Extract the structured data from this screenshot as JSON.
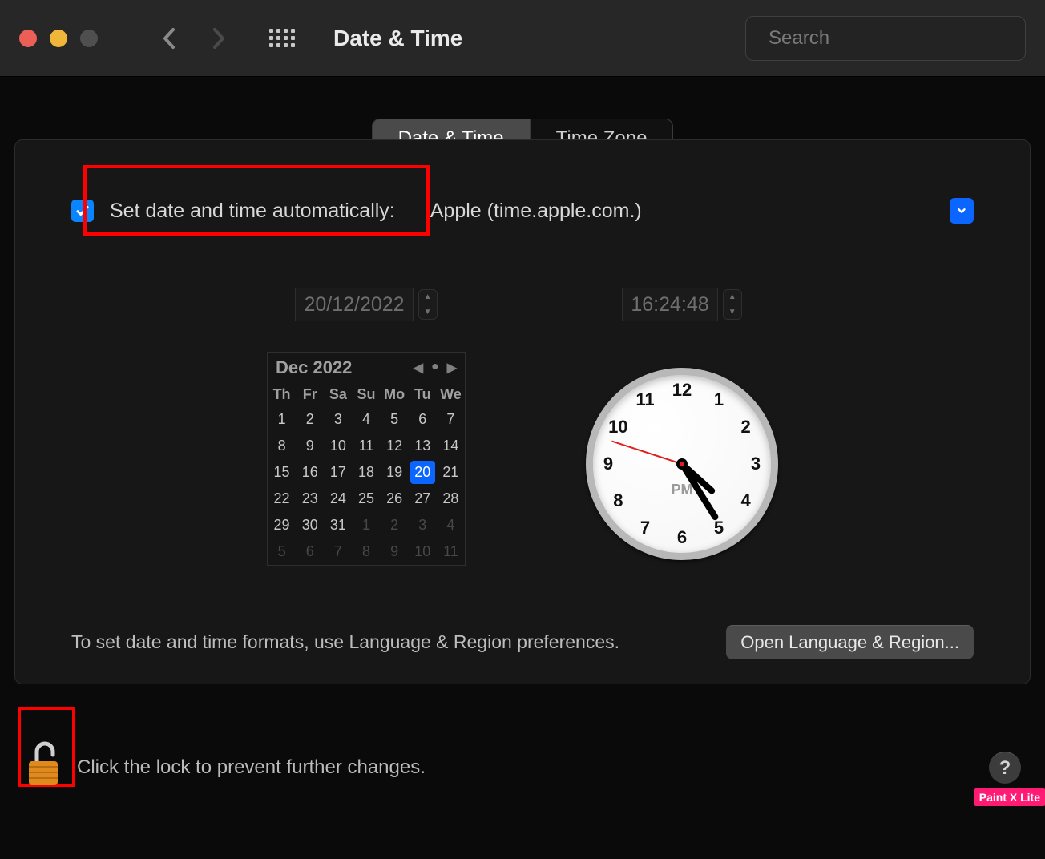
{
  "window": {
    "title": "Date & Time"
  },
  "search": {
    "placeholder": "Search",
    "value": ""
  },
  "tabs": {
    "date_time": "Date & Time",
    "time_zone": "Time Zone"
  },
  "auto": {
    "checked": true,
    "label": "Set date and time automatically:",
    "server": "Apple (time.apple.com.)"
  },
  "date_field": "20/12/2022",
  "time_field": "16:24:48",
  "calendar": {
    "month_label": "Dec 2022",
    "dow": [
      "Th",
      "Fr",
      "Sa",
      "Su",
      "Mo",
      "Tu",
      "We"
    ],
    "weeks": [
      [
        {
          "d": "1"
        },
        {
          "d": "2"
        },
        {
          "d": "3"
        },
        {
          "d": "4"
        },
        {
          "d": "5"
        },
        {
          "d": "6"
        },
        {
          "d": "7"
        }
      ],
      [
        {
          "d": "8"
        },
        {
          "d": "9"
        },
        {
          "d": "10"
        },
        {
          "d": "11"
        },
        {
          "d": "12"
        },
        {
          "d": "13"
        },
        {
          "d": "14"
        }
      ],
      [
        {
          "d": "15"
        },
        {
          "d": "16"
        },
        {
          "d": "17"
        },
        {
          "d": "18"
        },
        {
          "d": "19"
        },
        {
          "d": "20",
          "sel": true
        },
        {
          "d": "21"
        }
      ],
      [
        {
          "d": "22"
        },
        {
          "d": "23"
        },
        {
          "d": "24"
        },
        {
          "d": "25"
        },
        {
          "d": "26"
        },
        {
          "d": "27"
        },
        {
          "d": "28"
        }
      ],
      [
        {
          "d": "29"
        },
        {
          "d": "30"
        },
        {
          "d": "31"
        },
        {
          "d": "1",
          "out": true
        },
        {
          "d": "2",
          "out": true
        },
        {
          "d": "3",
          "out": true
        },
        {
          "d": "4",
          "out": true
        }
      ],
      [
        {
          "d": "5",
          "out": true
        },
        {
          "d": "6",
          "out": true
        },
        {
          "d": "7",
          "out": true
        },
        {
          "d": "8",
          "out": true
        },
        {
          "d": "9",
          "out": true
        },
        {
          "d": "10",
          "out": true
        },
        {
          "d": "11",
          "out": true
        }
      ]
    ]
  },
  "clock": {
    "ampm": "PM",
    "hour_hand_deg": 132,
    "minute_hand_deg": 148,
    "second_hand_deg": 288,
    "numbers": [
      "12",
      "1",
      "2",
      "3",
      "4",
      "5",
      "6",
      "7",
      "8",
      "9",
      "10",
      "11"
    ]
  },
  "formats": {
    "text": "To set date and time formats, use Language & Region preferences.",
    "button": "Open Language & Region..."
  },
  "lock": {
    "text": "Click the lock to prevent further changes."
  },
  "help_label": "?",
  "watermark": "Paint X Lite"
}
